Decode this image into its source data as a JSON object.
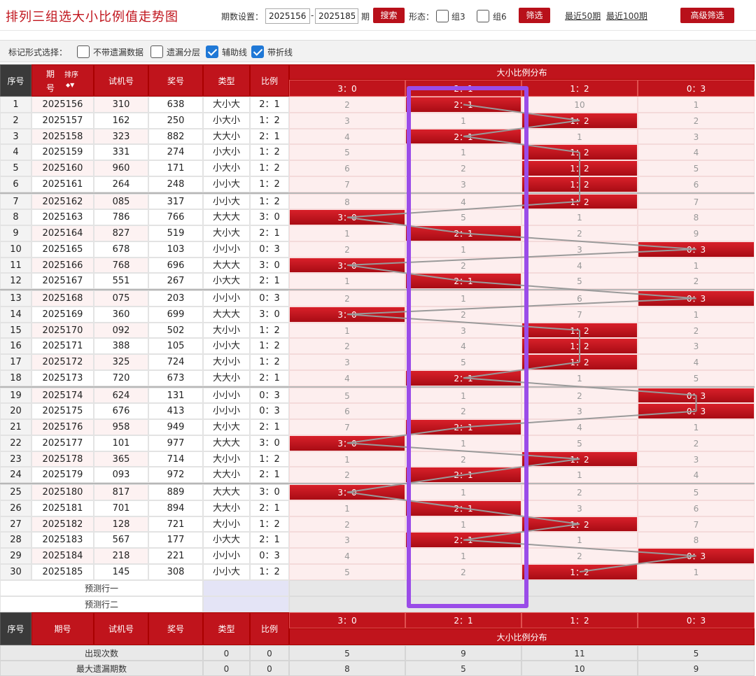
{
  "page_title": "排列三组选大小比例值走势图",
  "period_settings": {
    "label": "期数设置：",
    "from": "2025156",
    "dash": "-",
    "to": "2025185",
    "unit": "期",
    "search_label": "搜索",
    "form_label": "形态：",
    "group3_label": "组3",
    "group6_label": "组6",
    "filter_label": "筛选",
    "recent50": "最近50期",
    "recent100": "最近100期",
    "advanced_filter": "高级筛选"
  },
  "marker_options": {
    "label": "标记形式选择：",
    "opts": [
      {
        "label": "不带遗漏数据",
        "checked": false
      },
      {
        "label": "遗漏分层",
        "checked": false
      },
      {
        "label": "辅助线",
        "checked": true
      },
      {
        "label": "带折线",
        "checked": true
      }
    ]
  },
  "header": {
    "seq": "序号",
    "period_top": "期",
    "period_bottom": "号",
    "sort": "排序",
    "test_no": "试机号",
    "draw_no": "奖号",
    "type": "类型",
    "ratio": "比例",
    "dist_title": "大小比例分布",
    "dist_cols": [
      "3：0",
      "2：1",
      "1：2",
      "0：3"
    ]
  },
  "footer_header": {
    "seq": "序号",
    "period": "期号",
    "test_no": "试机号",
    "draw_no": "奖号",
    "type": "类型",
    "ratio": "比例"
  },
  "rows": [
    {
      "seq": "1",
      "period": "2025156",
      "test": "310",
      "draw": "638",
      "type": "大小大",
      "ratio": "2：1",
      "dist": [
        "2",
        "2：1",
        "10",
        "1"
      ]
    },
    {
      "seq": "2",
      "period": "2025157",
      "test": "162",
      "draw": "250",
      "type": "小大小",
      "ratio": "1：2",
      "dist": [
        "3",
        "1",
        "1：2",
        "2"
      ]
    },
    {
      "seq": "3",
      "period": "2025158",
      "test": "323",
      "draw": "882",
      "type": "大大小",
      "ratio": "2：1",
      "dist": [
        "4",
        "2：1",
        "1",
        "3"
      ]
    },
    {
      "seq": "4",
      "period": "2025159",
      "test": "331",
      "draw": "274",
      "type": "小大小",
      "ratio": "1：2",
      "dist": [
        "5",
        "1",
        "1：2",
        "4"
      ]
    },
    {
      "seq": "5",
      "period": "2025160",
      "test": "960",
      "draw": "171",
      "type": "小大小",
      "ratio": "1：2",
      "dist": [
        "6",
        "2",
        "1：2",
        "5"
      ]
    },
    {
      "seq": "6",
      "period": "2025161",
      "test": "264",
      "draw": "248",
      "type": "小小大",
      "ratio": "1：2",
      "dist": [
        "7",
        "3",
        "1：2",
        "6"
      ]
    },
    {
      "seq": "7",
      "period": "2025162",
      "test": "085",
      "draw": "317",
      "type": "小小大",
      "ratio": "1：2",
      "dist": [
        "8",
        "4",
        "1：2",
        "7"
      ]
    },
    {
      "seq": "8",
      "period": "2025163",
      "test": "786",
      "draw": "766",
      "type": "大大大",
      "ratio": "3：0",
      "dist": [
        "3：0",
        "5",
        "1",
        "8"
      ]
    },
    {
      "seq": "9",
      "period": "2025164",
      "test": "827",
      "draw": "519",
      "type": "大小大",
      "ratio": "2：1",
      "dist": [
        "1",
        "2：1",
        "2",
        "9"
      ]
    },
    {
      "seq": "10",
      "period": "2025165",
      "test": "678",
      "draw": "103",
      "type": "小小小",
      "ratio": "0：3",
      "dist": [
        "2",
        "1",
        "3",
        "0：3"
      ]
    },
    {
      "seq": "11",
      "period": "2025166",
      "test": "768",
      "draw": "696",
      "type": "大大大",
      "ratio": "3：0",
      "dist": [
        "3：0",
        "2",
        "4",
        "1"
      ]
    },
    {
      "seq": "12",
      "period": "2025167",
      "test": "551",
      "draw": "267",
      "type": "小大大",
      "ratio": "2：1",
      "dist": [
        "1",
        "2：1",
        "5",
        "2"
      ]
    },
    {
      "seq": "13",
      "period": "2025168",
      "test": "075",
      "draw": "203",
      "type": "小小小",
      "ratio": "0：3",
      "dist": [
        "2",
        "1",
        "6",
        "0：3"
      ]
    },
    {
      "seq": "14",
      "period": "2025169",
      "test": "360",
      "draw": "699",
      "type": "大大大",
      "ratio": "3：0",
      "dist": [
        "3：0",
        "2",
        "7",
        "1"
      ]
    },
    {
      "seq": "15",
      "period": "2025170",
      "test": "092",
      "draw": "502",
      "type": "大小小",
      "ratio": "1：2",
      "dist": [
        "1",
        "3",
        "1：2",
        "2"
      ]
    },
    {
      "seq": "16",
      "period": "2025171",
      "test": "388",
      "draw": "105",
      "type": "小小大",
      "ratio": "1：2",
      "dist": [
        "2",
        "4",
        "1：2",
        "3"
      ]
    },
    {
      "seq": "17",
      "period": "2025172",
      "test": "325",
      "draw": "724",
      "type": "大小小",
      "ratio": "1：2",
      "dist": [
        "3",
        "5",
        "1：2",
        "4"
      ]
    },
    {
      "seq": "18",
      "period": "2025173",
      "test": "720",
      "draw": "673",
      "type": "大大小",
      "ratio": "2：1",
      "dist": [
        "4",
        "2：1",
        "1",
        "5"
      ]
    },
    {
      "seq": "19",
      "period": "2025174",
      "test": "624",
      "draw": "131",
      "type": "小小小",
      "ratio": "0：3",
      "dist": [
        "5",
        "1",
        "2",
        "0：3"
      ]
    },
    {
      "seq": "20",
      "period": "2025175",
      "test": "676",
      "draw": "413",
      "type": "小小小",
      "ratio": "0：3",
      "dist": [
        "6",
        "2",
        "3",
        "0：3"
      ]
    },
    {
      "seq": "21",
      "period": "2025176",
      "test": "958",
      "draw": "949",
      "type": "大小大",
      "ratio": "2：1",
      "dist": [
        "7",
        "2：1",
        "4",
        "1"
      ]
    },
    {
      "seq": "22",
      "period": "2025177",
      "test": "101",
      "draw": "977",
      "type": "大大大",
      "ratio": "3：0",
      "dist": [
        "3：0",
        "1",
        "5",
        "2"
      ]
    },
    {
      "seq": "23",
      "period": "2025178",
      "test": "365",
      "draw": "714",
      "type": "大小小",
      "ratio": "1：2",
      "dist": [
        "1",
        "2",
        "1：2",
        "3"
      ]
    },
    {
      "seq": "24",
      "period": "2025179",
      "test": "093",
      "draw": "972",
      "type": "大大小",
      "ratio": "2：1",
      "dist": [
        "2",
        "2：1",
        "1",
        "4"
      ]
    },
    {
      "seq": "25",
      "period": "2025180",
      "test": "817",
      "draw": "889",
      "type": "大大大",
      "ratio": "3：0",
      "dist": [
        "3：0",
        "1",
        "2",
        "5"
      ]
    },
    {
      "seq": "26",
      "period": "2025181",
      "test": "701",
      "draw": "894",
      "type": "大大小",
      "ratio": "2：1",
      "dist": [
        "1",
        "2：1",
        "3",
        "6"
      ]
    },
    {
      "seq": "27",
      "period": "2025182",
      "test": "128",
      "draw": "721",
      "type": "大小小",
      "ratio": "1：2",
      "dist": [
        "2",
        "1",
        "1：2",
        "7"
      ]
    },
    {
      "seq": "28",
      "period": "2025183",
      "test": "567",
      "draw": "177",
      "type": "小大大",
      "ratio": "2：1",
      "dist": [
        "3",
        "2：1",
        "1",
        "8"
      ]
    },
    {
      "seq": "29",
      "period": "2025184",
      "test": "218",
      "draw": "221",
      "type": "小小小",
      "ratio": "0：3",
      "dist": [
        "4",
        "1",
        "2",
        "0：3"
      ]
    },
    {
      "seq": "30",
      "period": "2025185",
      "test": "145",
      "draw": "308",
      "type": "小小大",
      "ratio": "1：2",
      "dist": [
        "5",
        "2",
        "1：2",
        "1"
      ]
    }
  ],
  "predict_rows": [
    "预测行一",
    "预测行二"
  ],
  "stats": [
    {
      "label": "出现次数",
      "type": "0",
      "ratio": "0",
      "dist": [
        "5",
        "9",
        "11",
        "5"
      ]
    },
    {
      "label": "最大遗漏期数",
      "type": "0",
      "ratio": "0",
      "dist": [
        "8",
        "5",
        "10",
        "9"
      ]
    }
  ],
  "colors": {
    "accent": "#c0141c",
    "highlight_box": "#9a4ce8",
    "checkbox_on": "#1f78d6"
  }
}
